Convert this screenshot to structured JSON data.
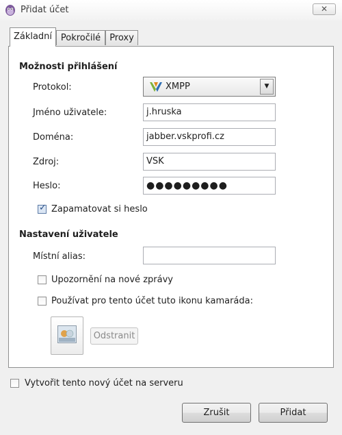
{
  "window": {
    "title": "Přidat účet",
    "close_glyph": "✕",
    "icon": "pidgin-icon"
  },
  "tabs": [
    {
      "label": "Základní",
      "active": true
    },
    {
      "label": "Pokročilé",
      "active": false
    },
    {
      "label": "Proxy",
      "active": false
    }
  ],
  "login_options": {
    "heading": "Možnosti přihlášení",
    "protocol": {
      "label": "Protokol:",
      "value": "XMPP",
      "icon": "xmpp-icon"
    },
    "username": {
      "label": "Jméno uživatele:",
      "value": "j.hruska"
    },
    "domain": {
      "label": "Doména:",
      "value": "jabber.vskprofi.cz"
    },
    "resource": {
      "label": "Zdroj:",
      "value": "VSK"
    },
    "password": {
      "label": "Heslo:",
      "value": "●●●●●●●●●"
    },
    "remember_password": {
      "label": "Zapamatovat si heslo",
      "checked": true
    }
  },
  "user_settings": {
    "heading": "Nastavení uživatele",
    "local_alias": {
      "label": "Místní alias:",
      "value": ""
    },
    "new_mail_notify": {
      "label": "Upozornění na nové zprávy",
      "checked": false
    },
    "use_buddy_icon": {
      "label": "Používat pro tento účet tuto ikonu kamaráda:",
      "checked": false
    },
    "remove_button": "Odstranit"
  },
  "create_account": {
    "label": "Vytvořit tento nový účet na serveru",
    "checked": false
  },
  "buttons": {
    "cancel": "Zrušit",
    "add": "Přidat"
  },
  "colors": {
    "check_mark": "#2a4f86",
    "xmpp_green": "#7fb13b",
    "xmpp_blue": "#2f6fb5"
  }
}
